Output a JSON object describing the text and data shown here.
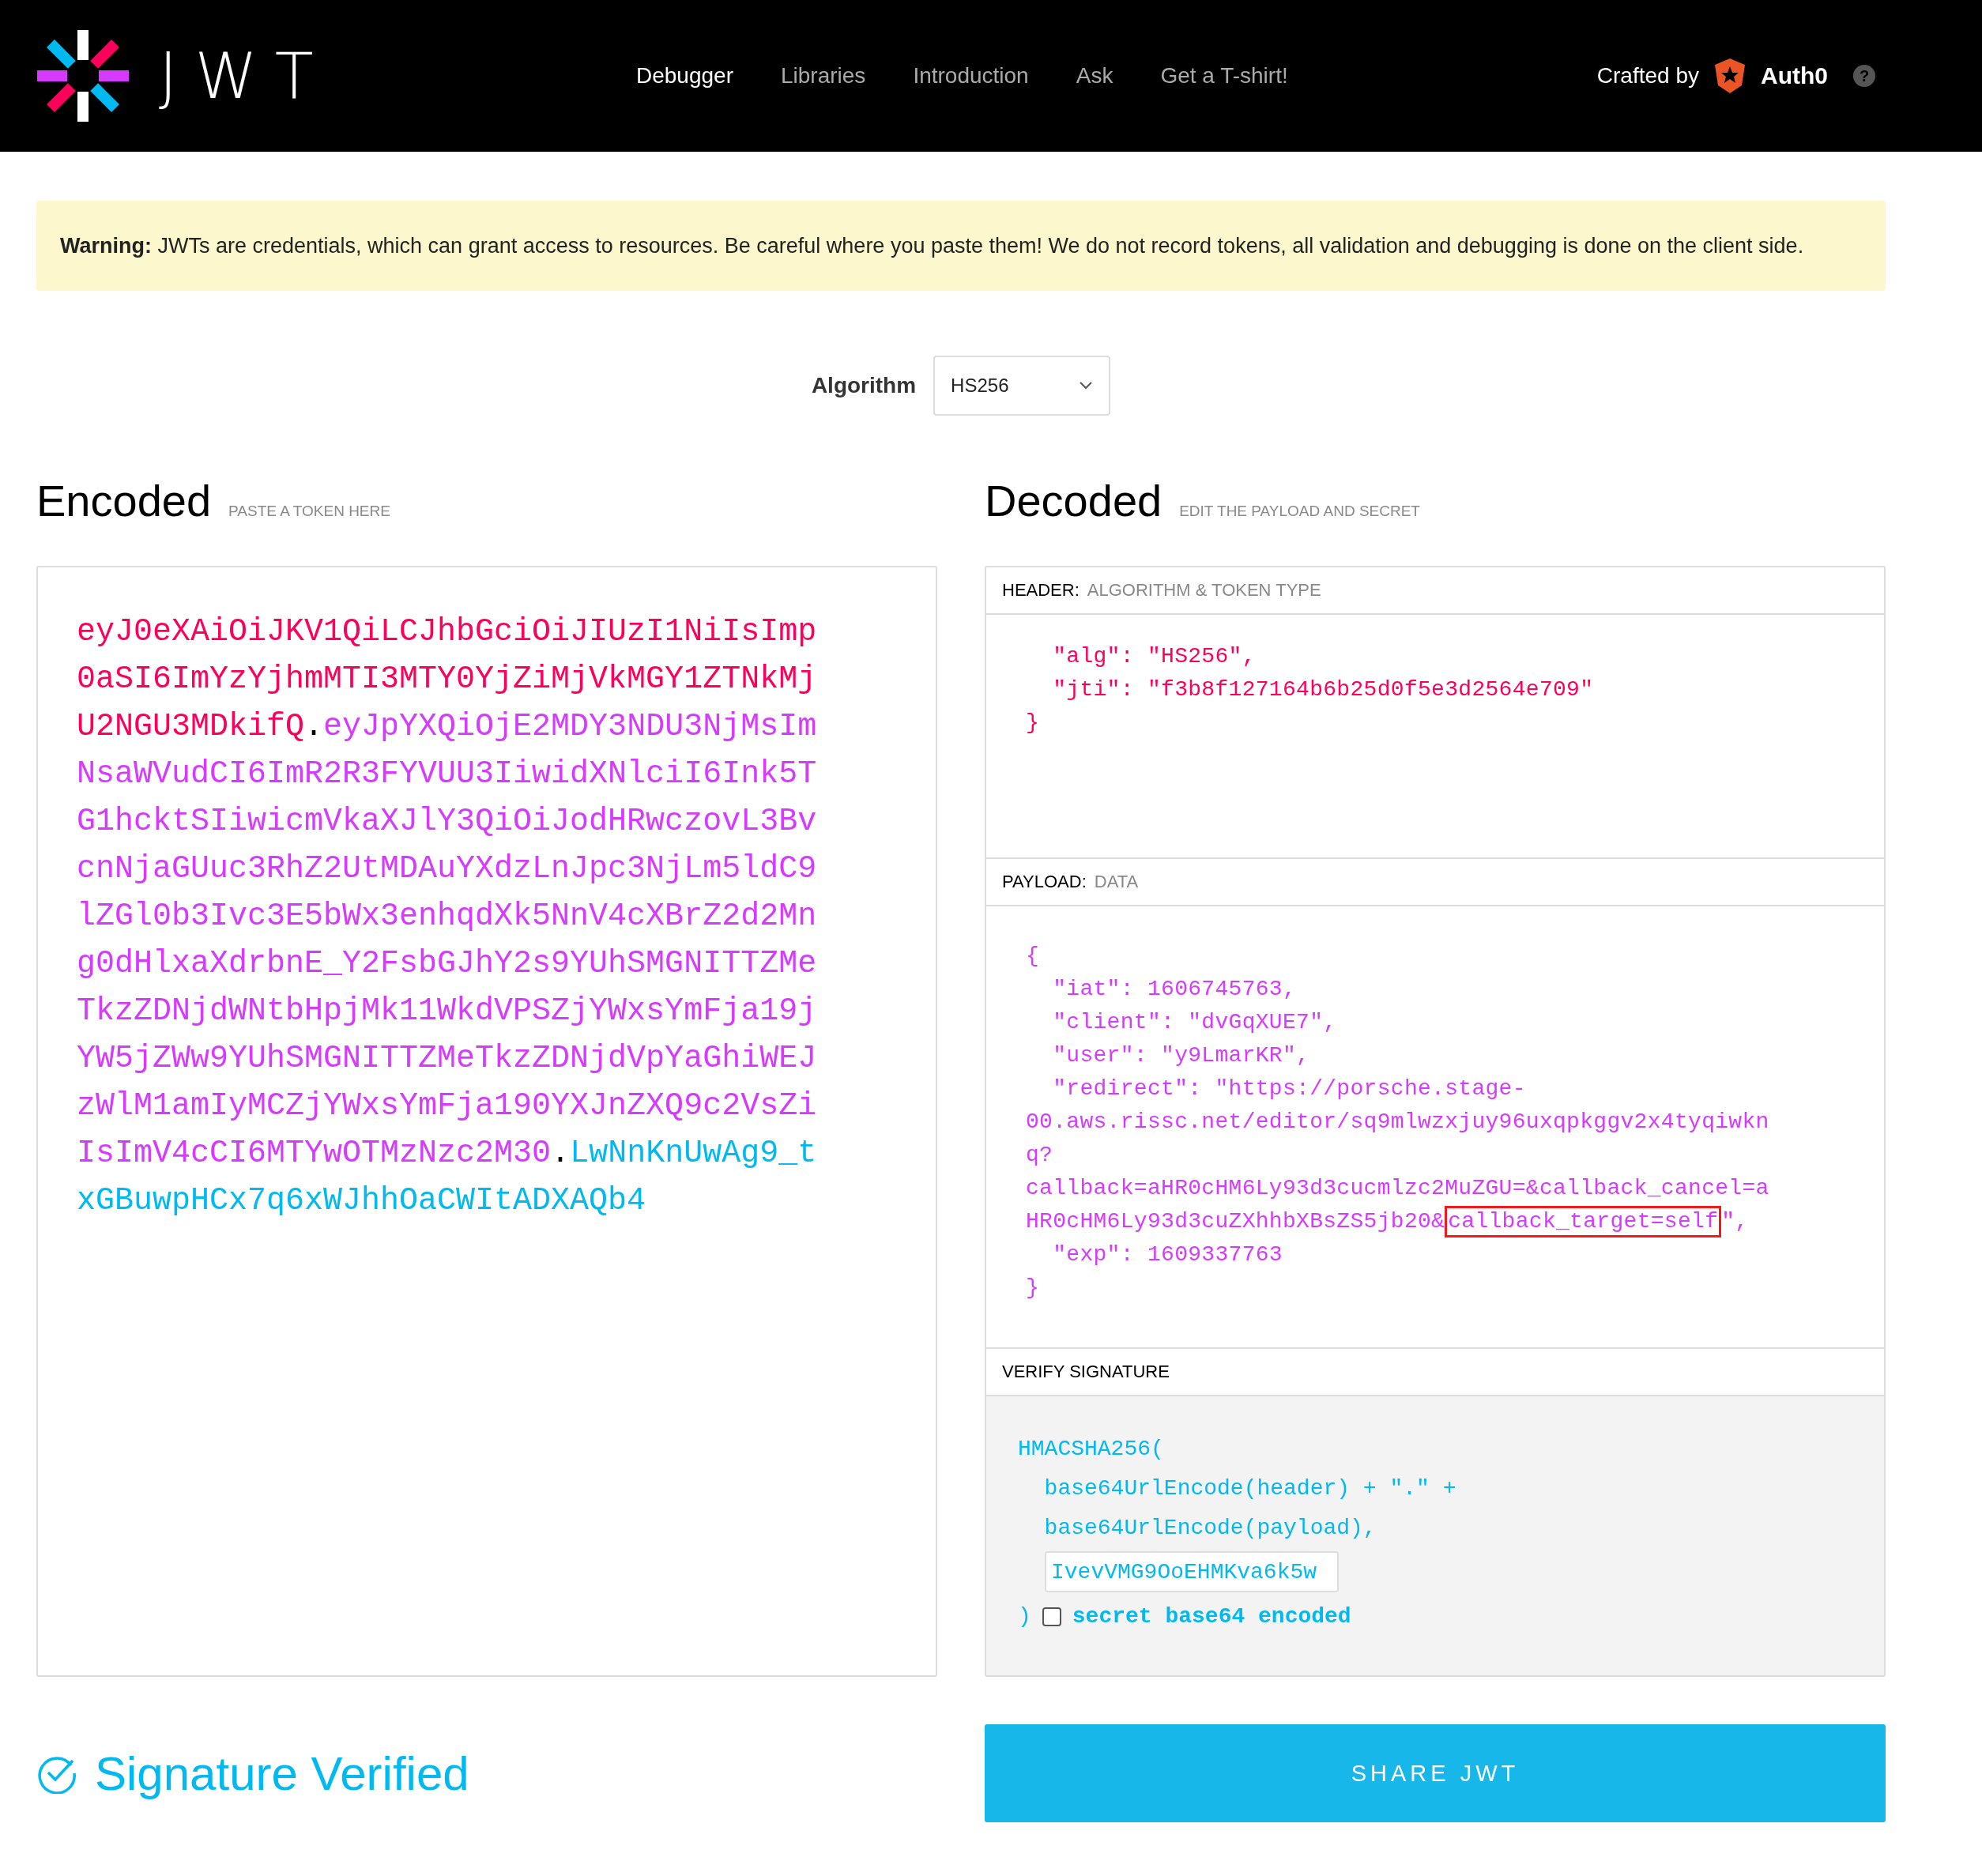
{
  "nav": {
    "logo_text": "JWT",
    "links": [
      {
        "label": "Debugger",
        "selected": true
      },
      {
        "label": "Libraries",
        "selected": false
      },
      {
        "label": "Introduction",
        "selected": false
      },
      {
        "label": "Ask",
        "selected": false
      },
      {
        "label": "Get a T-shirt!",
        "selected": false
      }
    ],
    "crafted_by": "Crafted by",
    "brand": "Auth0",
    "help": "?"
  },
  "warning": "**Warning:** JWTs are credentials, which can grant access to resources. Be careful where you paste them! We do not record tokens, all validation and debugging is done on the client side.",
  "algorithm": {
    "label": "Algorithm",
    "value": "HS256"
  },
  "encoded": {
    "title": "Encoded",
    "subtitle": "PASTE A TOKEN HERE",
    "parts": [
      {
        "kind": "header",
        "text": "eyJ0eXAiOiJKV1QiLCJhbGciOiJIUzI1NiIsImp0aSI6ImYzYjhmMTI3MTY0YjZiMjVkMGY1ZTNkMjU2NGU3MDkifQ"
      },
      {
        "kind": "dot",
        "text": "."
      },
      {
        "kind": "payload",
        "text": "eyJpYXQiOjE2MDY3NDU3NjMsImNsaWVudCI6ImR2R3FYVUU3IiwidXNlciI6Ink5TG1hcktSIiwicmVkaXJlY3QiOiJodHRwczovL3BvcnNjaGUuc3RhZ2UtMDAuYXdzLnJpc3NjLm5ldC9lZGl0b3Ivc3E5bWx3enhqdXk5NnV4cXBrZ2d2Mng0dHlxaXdrbnE_Y2FsbGJhY2s9YUhSMGNITTZMeTkzZDNjdWNtbHpjMk11WkdVPSZjYWxsYmFja19jYW5jZWw9YUhSMGNITTZMeTkzZDNjdVpYaGhiWEJzWlM1amIyMCZjYWxsYmFja190YXJnZXQ9c2VsZiIsImV4cCI6MTYwOTMzNzc2M30"
      },
      {
        "kind": "dot",
        "text": "."
      },
      {
        "kind": "signature",
        "text": "LwNnKnUwAg9_txGBuwpHCx7q6xWJhhOaCWItADXAQb4"
      }
    ]
  },
  "decoded": {
    "title": "Decoded",
    "subtitle": "EDIT THE PAYLOAD AND SECRET",
    "header": {
      "label": "HEADER:",
      "sublabel": "ALGORITHM & TOKEN TYPE",
      "lines": [
        [
          {
            "text": "  \"alg\": \"HS256\","
          }
        ],
        [
          {
            "text": "  \"jti\": \"f3b8f127164b6b25d0f5e3d2564e709\""
          }
        ],
        [
          {
            "text": "}"
          }
        ]
      ]
    },
    "payload": {
      "label": "PAYLOAD:",
      "sublabel": "DATA",
      "lines": [
        [
          {
            "text": "{"
          }
        ],
        [
          {
            "text": "  \"iat\": 1606745763,"
          }
        ],
        [
          {
            "text": "  \"client\": \"dvGqXUE7\","
          }
        ],
        [
          {
            "text": "  \"user\": \"y9LmarKR\","
          }
        ],
        [
          {
            "text": "  \"redirect\": \"https://porsche.stage-"
          }
        ],
        [
          {
            "text": "00.aws.rissc.net/editor/sq9mlwzxjuy96uxqpkggv2x4tyqiwkn"
          }
        ],
        [
          {
            "text": "q?"
          }
        ],
        [
          {
            "text": "callback=aHR0cHM6Ly93d3cucmlzc2MuZGU=&callback_cancel=a"
          }
        ],
        [
          {
            "text": "HR0cHM6Ly93d3cuZXhhbXBsZS5jb20&"
          },
          {
            "text": "callback_target=self",
            "highlighted": true
          },
          {
            "text": "\","
          }
        ],
        [
          {
            "text": "  \"exp\": 1609337763"
          }
        ],
        [
          {
            "text": "}"
          }
        ]
      ]
    },
    "verify": {
      "label": "VERIFY SIGNATURE",
      "lines": [
        "HMACSHA256(",
        "  base64UrlEncode(header) + \".\" +",
        "  base64UrlEncode(payload),"
      ],
      "secret": "IvevVMG9OoEHMKva6k5w",
      "close": ")",
      "checkbox": {
        "label": "secret base64 encoded",
        "checked": false
      }
    }
  },
  "status": "Signature Verified",
  "share_button": "SHARE JWT"
}
